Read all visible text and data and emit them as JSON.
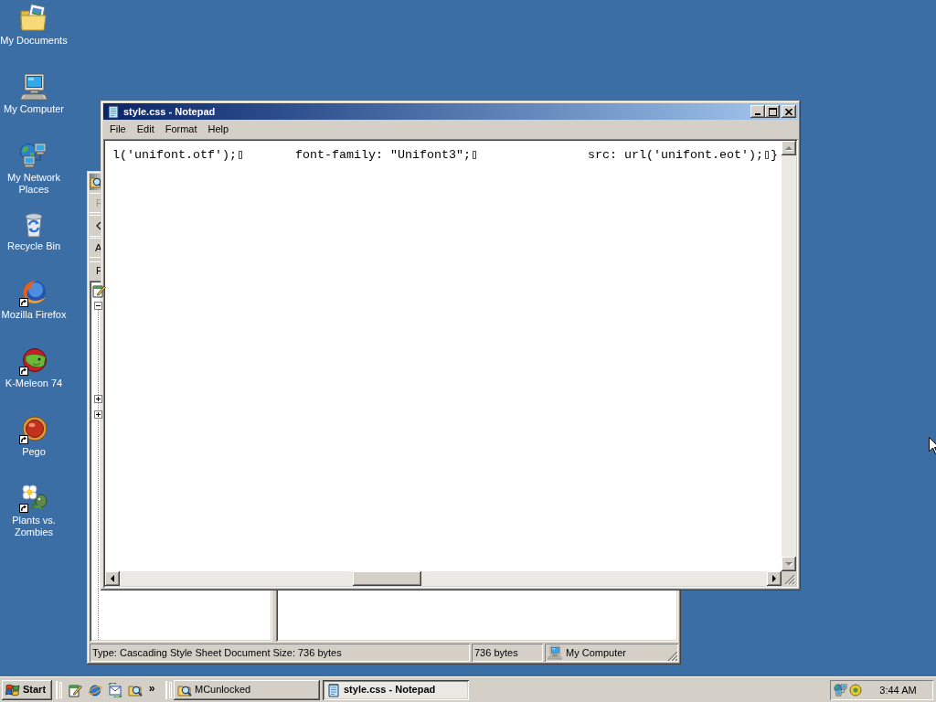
{
  "desktop": {
    "icons": [
      {
        "label": "My Documents",
        "shortcut": false
      },
      {
        "label": "My Computer",
        "shortcut": false
      },
      {
        "label": "My Network Places",
        "shortcut": false
      },
      {
        "label": "Recycle Bin",
        "shortcut": false
      },
      {
        "label": "Mozilla Firefox",
        "shortcut": true
      },
      {
        "label": "K-Meleon 74",
        "shortcut": true
      },
      {
        "label": "Pego",
        "shortcut": true
      },
      {
        "label": "Plants vs. Zombies",
        "shortcut": true
      }
    ]
  },
  "explorer_window": {
    "active": false,
    "toolbar_labels": [
      {
        "text": "F",
        "disabled": true
      },
      {
        "text": "A",
        "disabled": false
      }
    ],
    "pane_header": "F",
    "tree": {
      "nodes": [
        {
          "expanded": true
        },
        {
          "expanded": false
        },
        {
          "expanded": false
        }
      ]
    },
    "status_bar": {
      "description": "Type: Cascading Style Sheet Document Size: 736 bytes",
      "size": "736 bytes",
      "zone": "My Computer"
    }
  },
  "notepad_window": {
    "active": true,
    "title": "style.css - Notepad",
    "menu": [
      "File",
      "Edit",
      "Format",
      "Help"
    ],
    "text": "l('unifont.otf');▯       font-family: \"Unifont3\";▯               src: url('unifont.eot');▯}"
  },
  "taskbar": {
    "start_label": "Start",
    "more_label": "»",
    "tasks": [
      {
        "label": "MCunlocked",
        "selected": false
      },
      {
        "label": "style.css - Notepad",
        "selected": true
      }
    ],
    "clock": "3:44 AM"
  }
}
